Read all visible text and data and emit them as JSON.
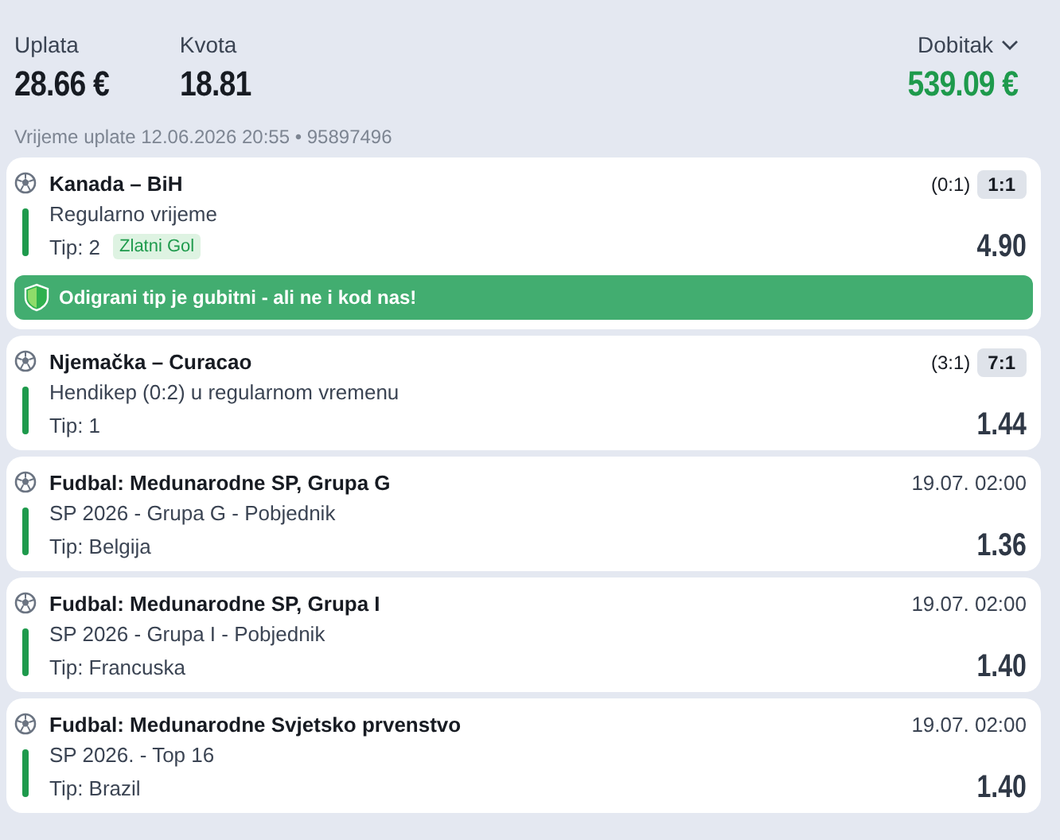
{
  "summary": {
    "stake_label": "Uplata",
    "stake": "28.66 €",
    "odds_label": "Kvota",
    "odds": "18.81",
    "win_label": "Dobitak",
    "win": "539.09 €",
    "meta": "Vrijeme uplate 12.06.2026 20:55 • 95897496"
  },
  "bets": [
    {
      "title": "Kanada – BiH",
      "market": "Regularno vrijeme",
      "tip": "Tip: 2",
      "tag": "Zlatni Gol",
      "score_ht": "(0:1)",
      "score": "1:1",
      "odds": "4.90",
      "won": true,
      "banner": "Odigrani tip je gubitni - ali ne i kod nas!"
    },
    {
      "title": "Njemačka – Curacao",
      "market": "Hendikep (0:2) u regularnom vremenu",
      "tip": "Tip: 1",
      "score_ht": "(3:1)",
      "score": "7:1",
      "odds": "1.44",
      "won": true
    },
    {
      "title": "Fudbal: Medunarodne SP, Grupa G",
      "market": "SP 2026 - Grupa G - Pobjednik",
      "tip": "Tip: Belgija",
      "date": "19.07. 02:00",
      "odds": "1.36",
      "won": true
    },
    {
      "title": "Fudbal: Medunarodne SP, Grupa I",
      "market": "SP 2026 - Grupa I - Pobjednik",
      "tip": "Tip: Francuska",
      "date": "19.07. 02:00",
      "odds": "1.40",
      "won": true
    },
    {
      "title": "Fudbal: Medunarodne Svjetsko prvenstvo",
      "market": "SP 2026. - Top 16",
      "tip": "Tip: Brazil",
      "date": "19.07. 02:00",
      "odds": "1.40",
      "won": true
    }
  ]
}
